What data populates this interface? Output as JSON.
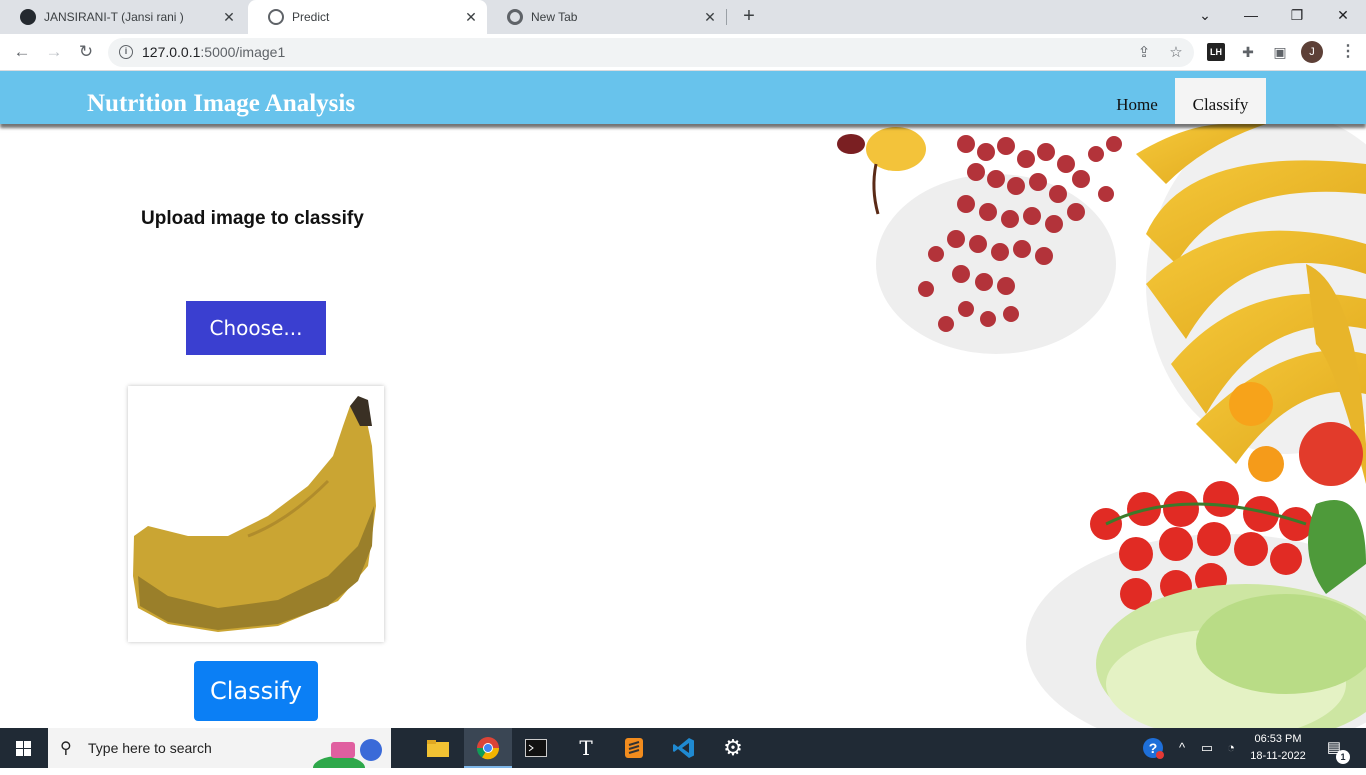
{
  "browser": {
    "tabs": [
      {
        "title": "JANSIRANI-T (Jansi rani )",
        "active": false
      },
      {
        "title": "Predict",
        "active": true
      },
      {
        "title": "New Tab",
        "active": false
      }
    ],
    "new_tab_symbol": "+",
    "close_symbol": "✕",
    "window_controls": {
      "dropdown": "⌄",
      "minimize": "—",
      "restore": "❐",
      "close": "✕"
    },
    "url_host": "127.0.0.1",
    "url_path": ":5000/image1",
    "profile_initial": "J",
    "extension_label": "LH"
  },
  "site": {
    "title": "Nutrition Image Analysis",
    "nav": [
      {
        "label": "Home",
        "active": false
      },
      {
        "label": "Classify",
        "active": true
      }
    ]
  },
  "main": {
    "heading": "Upload image to classify",
    "choose_button": "Choose...",
    "classify_button": "Classify",
    "preview_subject": "banana"
  },
  "taskbar": {
    "search_placeholder": "Type here to search",
    "apps": [
      "file-explorer",
      "chrome",
      "terminal",
      "typora",
      "sublime-text",
      "vscode",
      "settings"
    ],
    "clock_time": "06:53 PM",
    "clock_date": "18-11-2022",
    "notification_count": "1"
  },
  "colors": {
    "header_bg": "#68c3ec",
    "choose_btn": "#3a3fd0",
    "classify_btn": "#0b7ff5",
    "taskbar_bg": "#202a35"
  }
}
